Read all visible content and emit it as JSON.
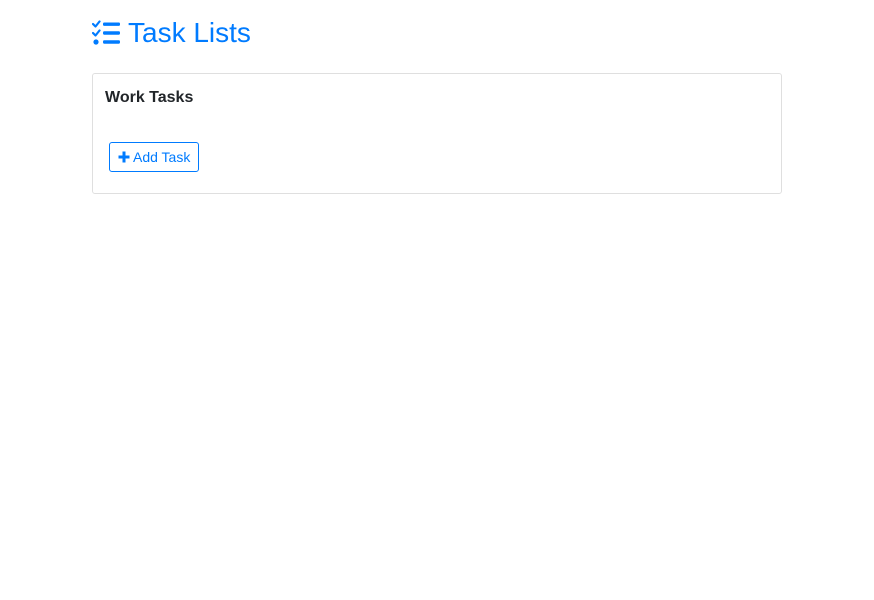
{
  "header": {
    "title": "Task Lists",
    "icon": "tasks-icon",
    "color": "#007bff"
  },
  "task_list": {
    "title": "Work Tasks",
    "add_button": {
      "label": "Add Task",
      "icon": "plus-icon"
    }
  }
}
